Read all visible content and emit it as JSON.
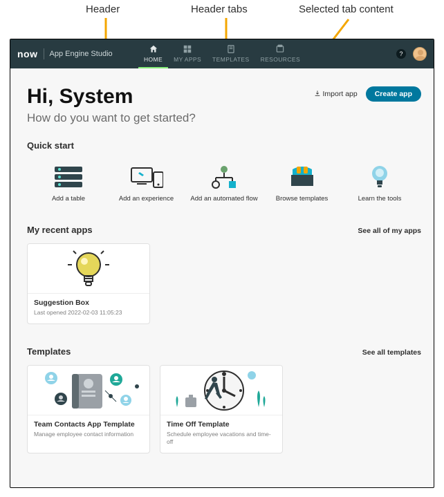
{
  "annotations": {
    "header": "Header",
    "tabs": "Header tabs",
    "content": "Selected tab content"
  },
  "header": {
    "logo": "now",
    "studio": "App Engine Studio",
    "tabs": [
      {
        "label": "HOME",
        "active": true
      },
      {
        "label": "MY APPS",
        "active": false
      },
      {
        "label": "TEMPLATES",
        "active": false
      },
      {
        "label": "RESOURCES",
        "active": false
      }
    ],
    "help": "?"
  },
  "hero": {
    "greeting": "Hi, System",
    "subtitle": "How do you want to get started?",
    "import": "Import app",
    "create": "Create app"
  },
  "quick_start": {
    "title": "Quick start",
    "items": [
      {
        "label": "Add a table"
      },
      {
        "label": "Add an experience"
      },
      {
        "label": "Add an automated flow"
      },
      {
        "label": "Browse templates"
      },
      {
        "label": "Learn the tools"
      }
    ]
  },
  "recent": {
    "title": "My recent apps",
    "see_all": "See all of my apps",
    "cards": [
      {
        "title": "Suggestion Box",
        "meta": "Last opened 2022-02-03 11:05:23"
      }
    ]
  },
  "templates": {
    "title": "Templates",
    "see_all": "See all templates",
    "cards": [
      {
        "title": "Team Contacts App Template",
        "meta": "Manage employee contact information"
      },
      {
        "title": "Time Off Template",
        "meta": "Schedule employee vacations and time-off"
      }
    ]
  }
}
